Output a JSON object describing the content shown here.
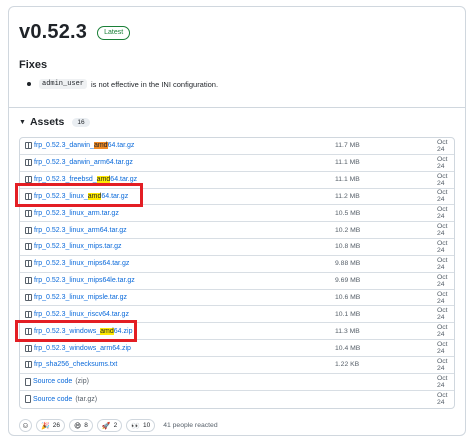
{
  "release": {
    "title": "v0.52.3",
    "badge": "Latest"
  },
  "fixes": {
    "heading": "Fixes",
    "items": [
      {
        "code": "admin_user",
        "text": "is not effective in the INI configuration."
      }
    ]
  },
  "assets": {
    "heading": "Assets",
    "count": "16",
    "rows": [
      {
        "pre": "frp_0.52.3_darwin_",
        "hl": "amd",
        "hl_color": "orange",
        "post": "64.tar.gz",
        "size": "11.7 MB",
        "date": "Oct 24"
      },
      {
        "pre": "frp_0.52.3_darwin_arm64.tar.gz",
        "hl": "",
        "post": "",
        "size": "11.1 MB",
        "date": "Oct 24"
      },
      {
        "pre": "frp_0.52.3_freebsd_",
        "hl": "amd",
        "hl_color": "yellow",
        "post": "64.tar.gz",
        "size": "11.1 MB",
        "date": "Oct 24"
      },
      {
        "pre": "frp_0.52.3_linux_",
        "hl": "amd",
        "hl_color": "yellow",
        "post": "64.tar.gz",
        "size": "11.2 MB",
        "date": "Oct 24"
      },
      {
        "pre": "frp_0.52.3_linux_arm.tar.gz",
        "hl": "",
        "post": "",
        "size": "10.5 MB",
        "date": "Oct 24"
      },
      {
        "pre": "frp_0.52.3_linux_arm64.tar.gz",
        "hl": "",
        "post": "",
        "size": "10.2 MB",
        "date": "Oct 24"
      },
      {
        "pre": "frp_0.52.3_linux_mips.tar.gz",
        "hl": "",
        "post": "",
        "size": "10.8 MB",
        "date": "Oct 24"
      },
      {
        "pre": "frp_0.52.3_linux_mips64.tar.gz",
        "hl": "",
        "post": "",
        "size": "9.88 MB",
        "date": "Oct 24"
      },
      {
        "pre": "frp_0.52.3_linux_mips64le.tar.gz",
        "hl": "",
        "post": "",
        "size": "9.69 MB",
        "date": "Oct 24"
      },
      {
        "pre": "frp_0.52.3_linux_mipsle.tar.gz",
        "hl": "",
        "post": "",
        "size": "10.6 MB",
        "date": "Oct 24"
      },
      {
        "pre": "frp_0.52.3_linux_riscv64.tar.gz",
        "hl": "",
        "post": "",
        "size": "10.1 MB",
        "date": "Oct 24"
      },
      {
        "pre": "frp_0.52.3_windows_",
        "hl": "amd",
        "hl_color": "yellow",
        "post": "64.zip",
        "size": "11.3 MB",
        "date": "Oct 24"
      },
      {
        "pre": "frp_0.52.3_windows_arm64.zip",
        "hl": "",
        "post": "",
        "size": "10.4 MB",
        "date": "Oct 24"
      },
      {
        "pre": "frp_sha256_checksums.txt",
        "hl": "",
        "post": "",
        "size": "1.22 KB",
        "date": "Oct 24"
      },
      {
        "pre": "Source code",
        "suffix": "(zip)",
        "hl": "",
        "post": "",
        "size": "",
        "date": "Oct 24",
        "source": true
      },
      {
        "pre": "Source code",
        "suffix": "(tar.gz)",
        "hl": "",
        "post": "",
        "size": "",
        "date": "Oct 24",
        "source": true
      }
    ]
  },
  "reactions": {
    "items": [
      {
        "emoji": "🎉",
        "count": "26"
      },
      {
        "emoji": "😄",
        "count": "8"
      },
      {
        "emoji": "🚀",
        "count": "2"
      },
      {
        "emoji": "👀",
        "count": "10"
      }
    ],
    "summary": "41 people reacted"
  },
  "colors": {
    "highlight_box": "#e31e24",
    "link": "#0969da",
    "latest": "#1a7f37"
  }
}
